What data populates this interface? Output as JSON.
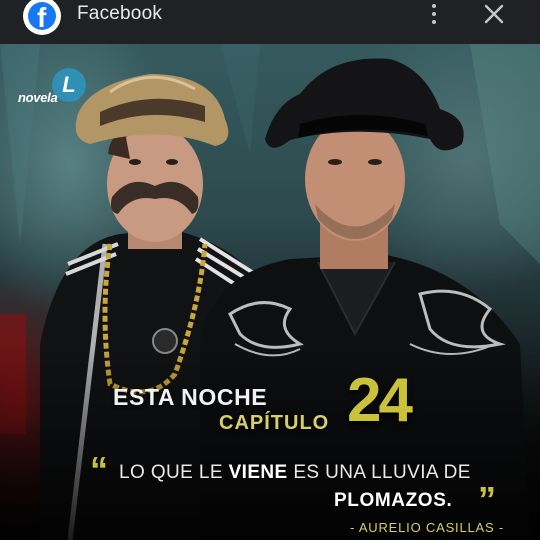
{
  "appbar": {
    "app_title": "Facebook",
    "logo_glyph": "f",
    "logo_color": "#1877f2",
    "background": "#202124",
    "icons": [
      "facebook-logo-icon",
      "more-vertical-icon",
      "close-icon"
    ]
  },
  "poster": {
    "brand_text": "novela",
    "brand_mark": "L",
    "headline": "ESTA NOCHE",
    "chapter_label": "CAPÍTULO",
    "chapter_number": "24",
    "quote": {
      "part1": "LO QUE LE ",
      "emphasis": "VIENE",
      "part2": " ES UNA LLUVIA DE",
      "line2": "PLOMAZOS.",
      "author": "- AURELIO CASILLAS -"
    },
    "accent_color": "#c9c23a"
  }
}
